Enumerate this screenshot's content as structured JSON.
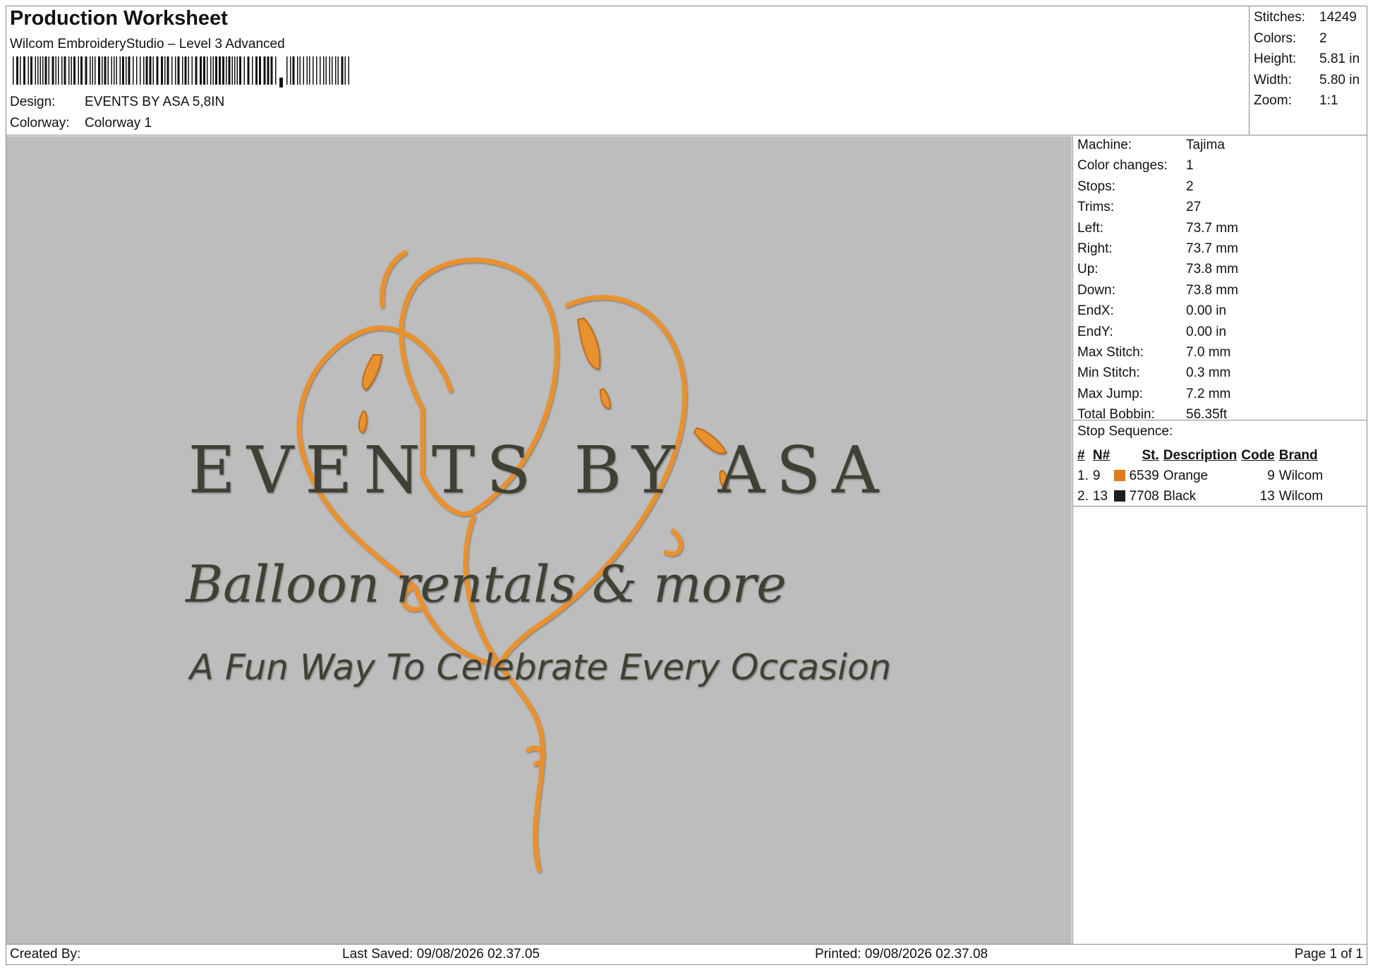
{
  "header": {
    "title": "Production Worksheet",
    "software": "Wilcom EmbroideryStudio – Level 3 Advanced",
    "design_label": "Design:",
    "design_value": "EVENTS BY ASA 5,8IN",
    "colorway_label": "Colorway:",
    "colorway_value": "Colorway 1"
  },
  "stats": [
    {
      "label": "Stitches:",
      "value": "14249"
    },
    {
      "label": "Colors:",
      "value": "2"
    },
    {
      "label": "Height:",
      "value": "5.81 in"
    },
    {
      "label": "Width:",
      "value": "5.80 in"
    },
    {
      "label": "Zoom:",
      "value": "1:1"
    }
  ],
  "machine_info": [
    {
      "label": "Machine:",
      "value": "Tajima"
    },
    {
      "label": "Color changes:",
      "value": "1"
    },
    {
      "label": "Stops:",
      "value": "2"
    },
    {
      "label": "Trims:",
      "value": "27"
    },
    {
      "label": "Left:",
      "value": "73.7 mm"
    },
    {
      "label": "Right:",
      "value": "73.7 mm"
    },
    {
      "label": "Up:",
      "value": "73.8 mm"
    },
    {
      "label": "Down:",
      "value": "73.8 mm"
    },
    {
      "label": "EndX:",
      "value": "0.00 in"
    },
    {
      "label": "EndY:",
      "value": "0.00 in"
    },
    {
      "label": "Max Stitch:",
      "value": "7.0 mm"
    },
    {
      "label": "Min Stitch:",
      "value": "0.3 mm"
    },
    {
      "label": "Max Jump:",
      "value": "7.2 mm"
    },
    {
      "label": "Total Bobbin:",
      "value": "56.35ft"
    }
  ],
  "stop_sequence": {
    "title": "Stop Sequence:",
    "headers": [
      "#",
      "N#",
      "St.",
      "Description",
      "Code",
      "Brand"
    ],
    "rows": [
      {
        "idx": "1.",
        "n": "9",
        "color": "#e07b20",
        "st": "6539",
        "desc": "Orange",
        "code": "9",
        "brand": "Wilcom"
      },
      {
        "idx": "2.",
        "n": "13",
        "color": "#1e1e1e",
        "st": "7708",
        "desc": "Black",
        "code": "13",
        "brand": "Wilcom"
      }
    ]
  },
  "design": {
    "line1": "EVENTS BY ASA",
    "line2": "Balloon rentals & more",
    "line3": "A Fun Way To Celebrate Every Occasion",
    "thread_orange": "#e8912e",
    "thread_dark": "#3f3f36",
    "fabric": "#bdbdbd"
  },
  "footer": {
    "created_by": "Created By:",
    "last_saved": "Last Saved: 09/08/2026 02.37.05",
    "printed": "Printed: 09/08/2026 02.37.08",
    "page": "Page 1 of 1"
  }
}
